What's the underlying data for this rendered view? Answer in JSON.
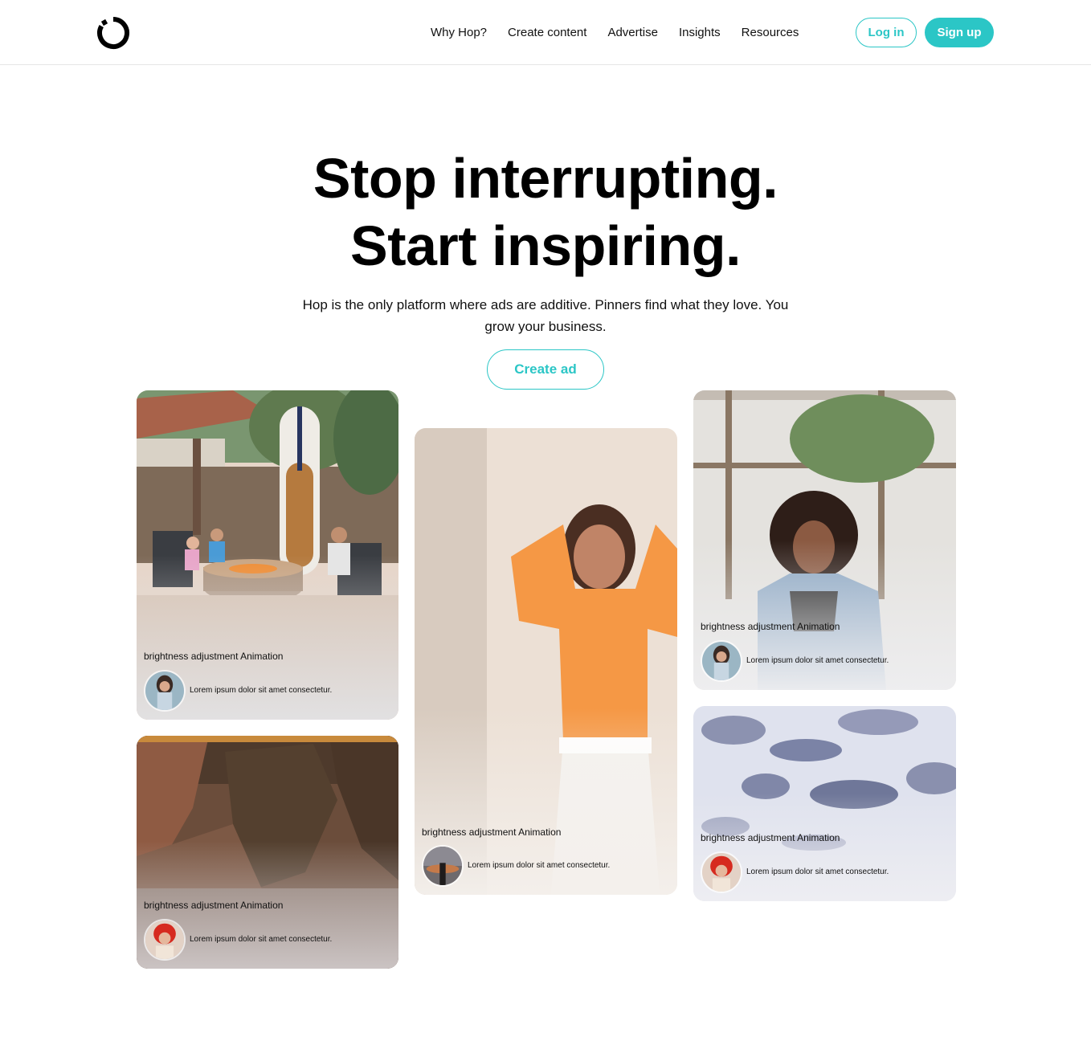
{
  "header": {
    "logo_icon": "ring-logo-icon",
    "nav": [
      "Why Hop?",
      "Create content",
      "Advertise",
      "Insights",
      "Resources"
    ],
    "login_label": "Log in",
    "signup_label": "Sign up"
  },
  "hero": {
    "title_line1": "Stop interrupting.",
    "title_line2": "Start inspiring.",
    "subtitle": "Hop is the only platform where ads are additive. Pinners find what they love. You grow your business.",
    "cta_label": "Create ad"
  },
  "cards": [
    {
      "title": "brightness adjustment Animation",
      "desc": "Lorem ipsum dolor sit amet consectetur."
    },
    {
      "title": "brightness adjustment Animation",
      "desc": "Lorem ipsum dolor sit amet consectetur."
    },
    {
      "title": "brightness adjustment Animation",
      "desc": "Lorem ipsum dolor sit amet consectetur."
    },
    {
      "title": "brightness adjustment Animation",
      "desc": "Lorem ipsum dolor sit amet consectetur."
    },
    {
      "title": "brightness adjustment Animation",
      "desc": "Lorem ipsum dolor sit amet consectetur."
    }
  ],
  "colors": {
    "accent": "#2bc6c6"
  }
}
